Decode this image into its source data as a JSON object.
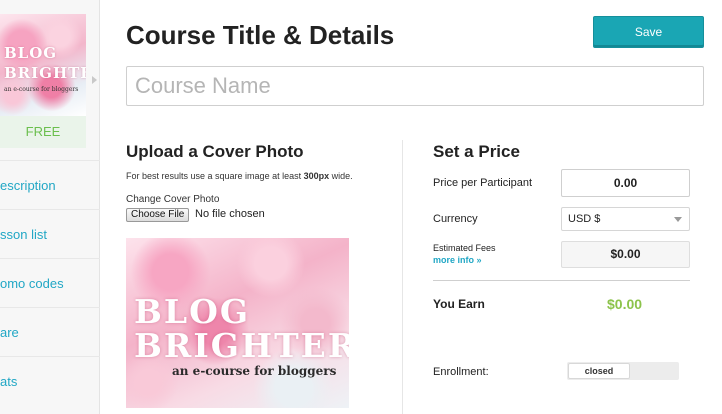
{
  "sidebar": {
    "thumbnail": {
      "title_line1": "BLOG",
      "title_line2": "BRIGHTER",
      "subtitle": "an e-course for bloggers"
    },
    "price_badge": "FREE",
    "items": [
      {
        "label": "escription"
      },
      {
        "label": "sson list"
      },
      {
        "label": "omo codes"
      },
      {
        "label": "are"
      },
      {
        "label": "ats"
      }
    ]
  },
  "header": {
    "title": "Course Title & Details",
    "save_label": "Save"
  },
  "course_name": {
    "placeholder": "Course Name",
    "value": ""
  },
  "upload": {
    "heading": "Upload a Cover Photo",
    "hint_prefix": "For best results use a square image at least ",
    "hint_bold": "300px",
    "hint_suffix": " wide.",
    "change_label": "Change Cover Photo",
    "choose_file_label": "Choose File",
    "no_file_text": "No file chosen",
    "cover": {
      "title_line1": "BLOG",
      "title_line2": "BRIGHTER",
      "subtitle": "an e-course for bloggers"
    }
  },
  "pricing": {
    "heading": "Set a Price",
    "price_label": "Price per Participant",
    "price_value": "0.00",
    "currency_label": "Currency",
    "currency_value": "USD $",
    "fees_label": "Estimated Fees",
    "more_info_label": "more info »",
    "fees_value": "$0.00",
    "you_earn_label": "You Earn",
    "you_earn_value": "$0.00",
    "enrollment_label": "Enrollment:",
    "enrollment_state": "closed"
  },
  "colors": {
    "accent": "#1aa6b4",
    "link": "#21a7c5",
    "earn_green": "#8cc34b",
    "free_green": "#6bbf4e"
  },
  "icons": [
    "chevron-right-icon",
    "chevron-down-icon"
  ]
}
